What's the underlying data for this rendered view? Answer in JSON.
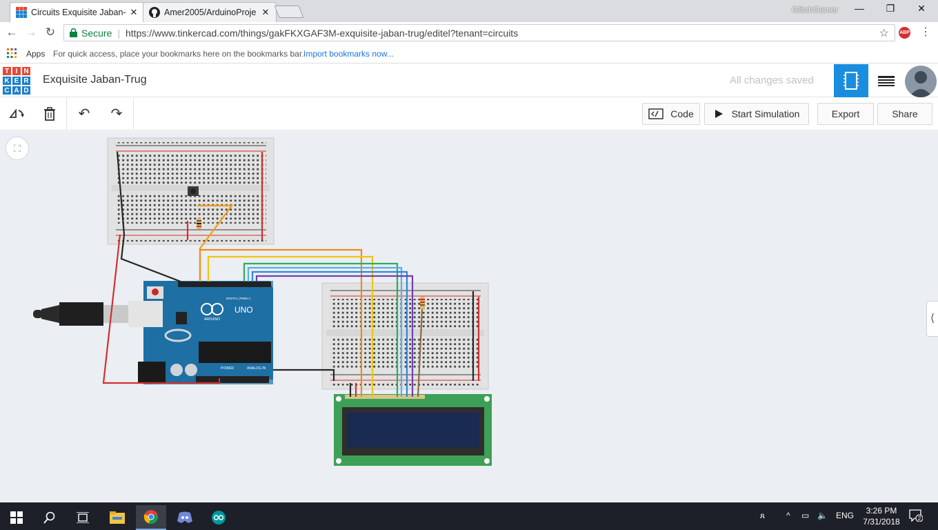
{
  "browser": {
    "tabs": [
      {
        "title": "Circuits Exquisite Jaban-T",
        "active": true
      },
      {
        "title": "Amer2005/ArduinoProje",
        "active": false
      }
    ],
    "profile_name": "GlitchGamer",
    "secure_label": "Secure",
    "url": "https://www.tinkercad.com/things/gakFKXGAF3M-exquisite-jaban-trug/editel?tenant=circuits",
    "bookmarks": {
      "apps_label": "Apps",
      "hint": "For quick access, place your bookmarks here on the bookmarks bar.",
      "import_link": "Import bookmarks now..."
    }
  },
  "app": {
    "logo_letters": [
      "T",
      "I",
      "N",
      "K",
      "E",
      "R",
      "C",
      "A",
      "D"
    ],
    "logo_colors": [
      "#e14b38",
      "#e14b38",
      "#e14b38",
      "#1b7fcc",
      "#1b7fcc",
      "#1b7fcc",
      "#1b7fcc",
      "#1b7fcc",
      "#1b7fcc"
    ],
    "design_title": "Exquisite Jaban-Trug",
    "save_status": "All changes saved",
    "toolbar": {
      "code_label": "Code",
      "start_sim_label": "Start Simulation",
      "export_label": "Export",
      "share_label": "Share"
    },
    "accent_color": "#1a8ddf"
  },
  "circuit": {
    "arduino_label": "UNO",
    "arduino_brand": "ARDUINO",
    "digital_label": "DIGITAL (PWM~)",
    "power_label": "POWER",
    "analog_label": "ANALOG IN",
    "components": [
      "breadboard-small-top",
      "breadboard-small-right",
      "arduino-uno",
      "usb-cable",
      "pushbutton",
      "resistor",
      "resistor",
      "lcd-16x2"
    ]
  },
  "taskbar": {
    "lang": "ENG",
    "time": "3:26 PM",
    "date": "7/31/2018",
    "notifications": "2"
  }
}
